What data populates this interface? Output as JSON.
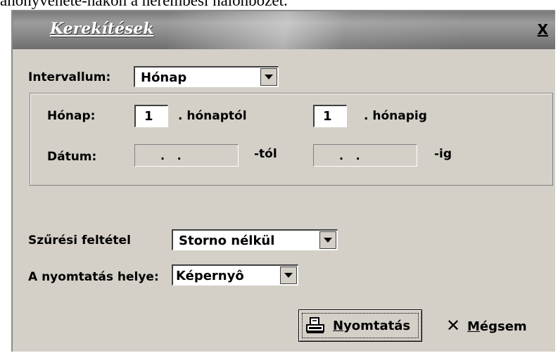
{
  "background_caption": "ahonyvenete-nakon a nerembesi nalonbozet.",
  "dialog": {
    "title": "Kerekítések",
    "close_label": "X"
  },
  "interval": {
    "label": "Intervallum:",
    "value": "Hónap"
  },
  "month_row": {
    "label": "Hónap:",
    "from_value": "1",
    "from_suffix": ". hónaptól",
    "to_value": "1",
    "to_suffix": ". hónapig"
  },
  "date_row": {
    "label": "Dátum:",
    "from_value": ". .",
    "from_suffix": "-tól",
    "to_value": ". .",
    "to_suffix": "-ig"
  },
  "filter": {
    "label": "Szűrési feltétel",
    "value": "Storno nélkül"
  },
  "print_location": {
    "label": "A nyomtatás helye:",
    "value": "Képernyô"
  },
  "buttons": {
    "print_mnemonic": "N",
    "print_rest": "yomtatás",
    "cancel_mnemonic": "M",
    "cancel_rest": "égsem",
    "cancel_icon": "x-icon",
    "print_icon": "printer-icon"
  },
  "colors": {
    "face": "#d4d0c8",
    "title_gray": "#8a8a8a"
  }
}
